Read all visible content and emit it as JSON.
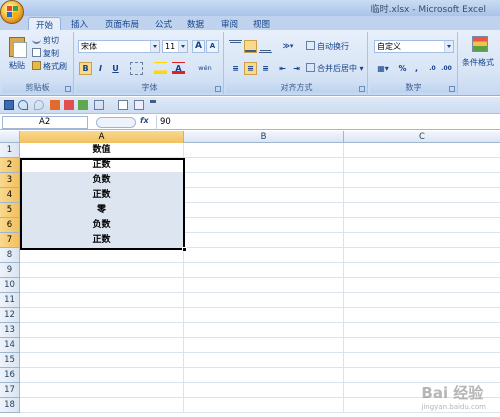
{
  "window": {
    "title": "临时.xlsx - Microsoft Excel"
  },
  "ribbon": {
    "tabs": [
      "开始",
      "插入",
      "页面布局",
      "公式",
      "数据",
      "审阅",
      "视图"
    ],
    "active_tab": "开始",
    "clipboard": {
      "label": "剪贴板",
      "paste": "粘贴",
      "cut": "剪切",
      "copy": "复制",
      "format_painter": "格式刷"
    },
    "font": {
      "label": "字体",
      "name": "宋体",
      "size": "11",
      "bold": "B",
      "italic": "I",
      "underline": "U",
      "grow": "A",
      "shrink": "A",
      "phonetic": "wén"
    },
    "alignment": {
      "label": "对齐方式",
      "wrap_text": "自动换行",
      "merge_center": "合并后居中"
    },
    "number": {
      "label": "数字",
      "format": "自定义",
      "percent": "%",
      "comma": ","
    },
    "styles": {
      "conditional_format": "条件格式"
    }
  },
  "formula_bar": {
    "name_box": "A2",
    "fx": "fx",
    "value": "90"
  },
  "sheet": {
    "columns": [
      "A",
      "B",
      "C"
    ],
    "selected_column": "A",
    "rows": [
      {
        "num": "1",
        "a": "数值"
      },
      {
        "num": "2",
        "a": "正数"
      },
      {
        "num": "3",
        "a": "负数"
      },
      {
        "num": "4",
        "a": "正数"
      },
      {
        "num": "5",
        "a": "零"
      },
      {
        "num": "6",
        "a": "负数"
      },
      {
        "num": "7",
        "a": "正数"
      },
      {
        "num": "8",
        "a": ""
      },
      {
        "num": "9",
        "a": ""
      },
      {
        "num": "10",
        "a": ""
      },
      {
        "num": "11",
        "a": ""
      },
      {
        "num": "12",
        "a": ""
      },
      {
        "num": "13",
        "a": ""
      },
      {
        "num": "14",
        "a": ""
      },
      {
        "num": "15",
        "a": ""
      },
      {
        "num": "16",
        "a": ""
      },
      {
        "num": "17",
        "a": ""
      },
      {
        "num": "18",
        "a": ""
      }
    ],
    "selected_rows": [
      "2",
      "3",
      "4",
      "5",
      "6",
      "7"
    ]
  },
  "watermark": {
    "brand": "Bai 经验",
    "url": "jingyan.baidu.com"
  }
}
